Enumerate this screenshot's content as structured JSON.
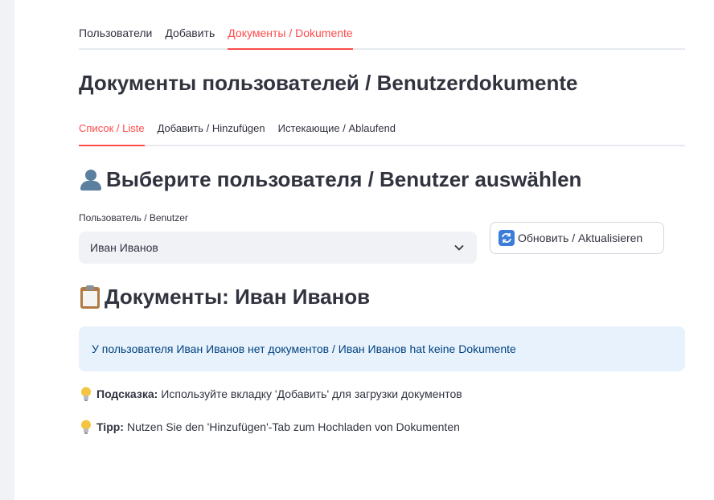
{
  "nav": {
    "tabs": [
      {
        "label": "Пользователи",
        "active": false
      },
      {
        "label": "Добавить",
        "active": false
      },
      {
        "label": "Документы / Dokumente",
        "active": true
      }
    ]
  },
  "page_title": "Документы пользователей / Benutzerdokumente",
  "sub_tabs": [
    {
      "label": "Список / Liste",
      "active": true
    },
    {
      "label": "Добавить / Hinzufügen",
      "active": false
    },
    {
      "label": "Истекающие / Ablaufend",
      "active": false
    }
  ],
  "select_user": {
    "heading": "Выберите пользователя / Benutzer auswählen",
    "icon": "user-silhouette-icon",
    "field_label": "Пользователь / Benutzer",
    "selected_value": "Иван Иванов",
    "refresh_label": "Обновить / Aktualisieren",
    "refresh_icon": "refresh-arrows-icon"
  },
  "documents": {
    "heading": "Документы: Иван Иванов",
    "icon": "clipboard-icon",
    "empty_message": "У пользователя Иван Иванов нет документов / Иван Иванов hat keine Dokumente"
  },
  "hints": [
    {
      "label": "Подсказка:",
      "text": "Используйте вкладку 'Добавить' для загрузки документов",
      "icon": "lightbulb-icon"
    },
    {
      "label": "Tipp:",
      "text": "Nutzen Sie den 'Hinzufügen'-Tab zum Hochladen von Dokumenten",
      "icon": "lightbulb-icon"
    }
  ],
  "colors": {
    "accent": "#ff4b4b",
    "info_bg": "#e8f2fc",
    "info_text": "#004280",
    "select_bg": "#f0f2f6"
  }
}
